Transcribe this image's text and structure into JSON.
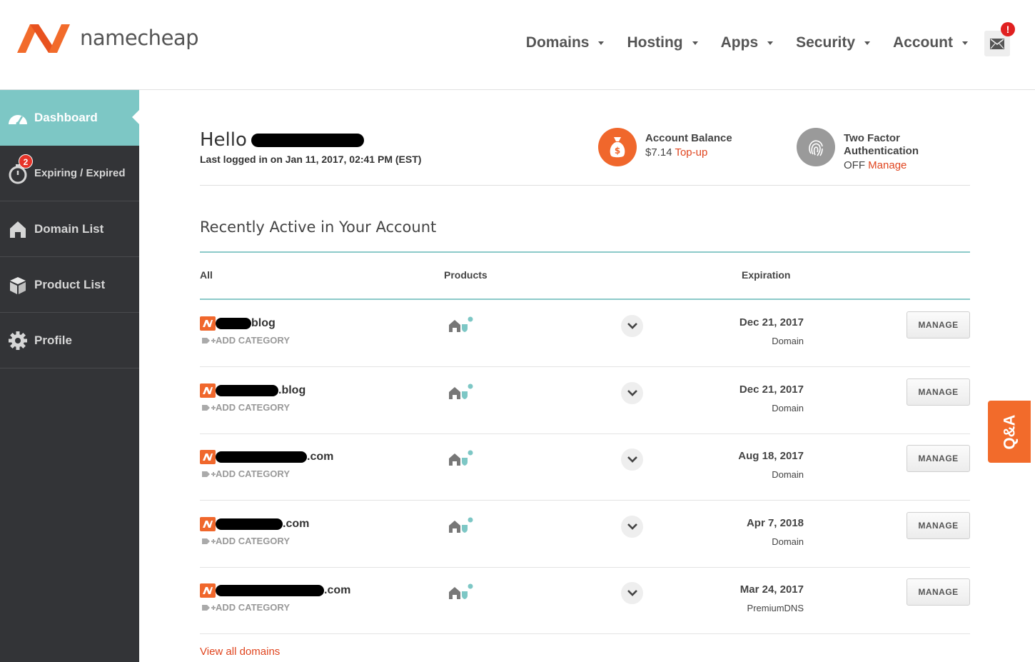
{
  "brand": {
    "name": "namecheap",
    "accent": "#f0672c",
    "teal": "#7dc7c5"
  },
  "topnav": [
    {
      "label": "Domains"
    },
    {
      "label": "Hosting"
    },
    {
      "label": "Apps"
    },
    {
      "label": "Security"
    },
    {
      "label": "Account"
    }
  ],
  "notifications": {
    "badge": "!",
    "icon": "mail-icon"
  },
  "sidebar": {
    "items": [
      {
        "label": "Dashboard",
        "icon": "speedometer-icon",
        "active": true
      },
      {
        "label": "Expiring / Expired",
        "icon": "stopwatch-icon",
        "badge": "2"
      },
      {
        "label": "Domain List",
        "icon": "house-icon"
      },
      {
        "label": "Product List",
        "icon": "box-icon"
      },
      {
        "label": "Profile",
        "icon": "gear-icon"
      }
    ]
  },
  "greeting": {
    "hello": "Hello",
    "last_login": "Last logged in on Jan 11, 2017, 02:41 PM (EST)"
  },
  "balance": {
    "title": "Account Balance",
    "amount": "$7.14",
    "action": "Top-up",
    "icon": "money-bag-icon"
  },
  "two_factor": {
    "title_line1": "Two Factor",
    "title_line2": "Authentication",
    "status": "OFF",
    "action": "Manage",
    "icon": "fingerprint-icon"
  },
  "recent": {
    "title": "Recently Active in Your Account",
    "columns": {
      "all": "All",
      "products": "Products",
      "expiration": "Expiration"
    },
    "add_category": "ADD CATEGORY",
    "manage_label": "MANAGE",
    "rows": [
      {
        "suffix": "blog",
        "date": "Dec 21, 2017",
        "type": "Domain"
      },
      {
        "suffix": ".blog",
        "date": "Dec 21, 2017",
        "type": "Domain"
      },
      {
        "suffix": ".com",
        "date": "Aug 18, 2017",
        "type": "Domain"
      },
      {
        "suffix": ".com",
        "date": "Apr 7, 2018",
        "type": "Domain"
      },
      {
        "suffix": ".com",
        "date": "Mar 24, 2017",
        "type": "PremiumDNS"
      }
    ],
    "view_all": "View all domains"
  },
  "qa_tab": {
    "label": "Q&A"
  }
}
